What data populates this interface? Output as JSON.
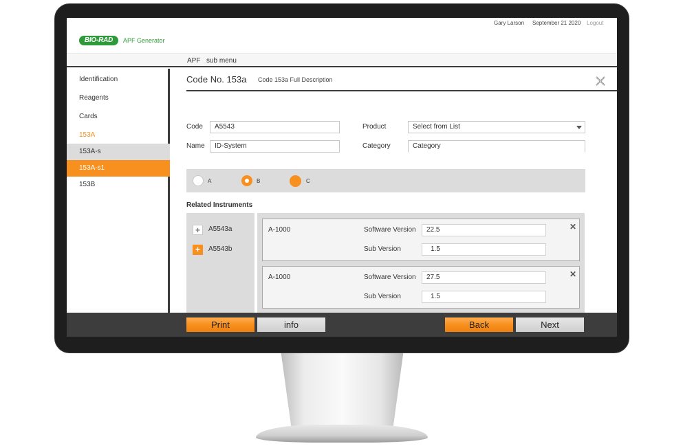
{
  "topbar": {
    "user": "Gary Larson",
    "date": "September 21 2020",
    "logout": "Logout"
  },
  "brand": {
    "logo": "BIO-RAD",
    "app": "APF Generator"
  },
  "submenu": {
    "apf": "APF",
    "sub": "sub menu"
  },
  "sidebar": {
    "items": [
      {
        "label": "Identification"
      },
      {
        "label": "Reagents"
      },
      {
        "label": "Cards"
      },
      {
        "label": "153A"
      },
      {
        "label": "153A-s"
      },
      {
        "label": "153A-s1"
      },
      {
        "label": "153B"
      }
    ]
  },
  "main": {
    "code_title": "Code No. 153a",
    "code_desc": "Code 153a Full Description",
    "close_icon": "close-icon"
  },
  "form": {
    "code_label": "Code",
    "code_value": "A5543",
    "name_label": "Name",
    "name_value": "ID-System",
    "product_label": "Product",
    "product_value": "Select from List",
    "category_label": "Category",
    "category_value": "Category"
  },
  "radios": {
    "a": "A",
    "b": "B",
    "c": "C"
  },
  "related": {
    "heading": "Related Instruments",
    "instruments": [
      {
        "name": "A5543a"
      },
      {
        "name": "A5543b"
      }
    ],
    "cards": [
      {
        "model": "A-1000",
        "sv_label": "Software Version",
        "sv_value": "22.5",
        "sub_label": "Sub Version",
        "sub_value": "1.5"
      },
      {
        "model": "A-1000",
        "sv_label": "Software Version",
        "sv_value": "27.5",
        "sub_label": "Sub Version",
        "sub_value": "1.5"
      }
    ]
  },
  "footer": {
    "print": "Print",
    "info": "info",
    "back": "Back",
    "next": "Next"
  },
  "colors": {
    "accent": "#f7901e",
    "brand": "#2f9a3a",
    "dark": "#3c3c3c",
    "panel": "#dcdcdc"
  }
}
